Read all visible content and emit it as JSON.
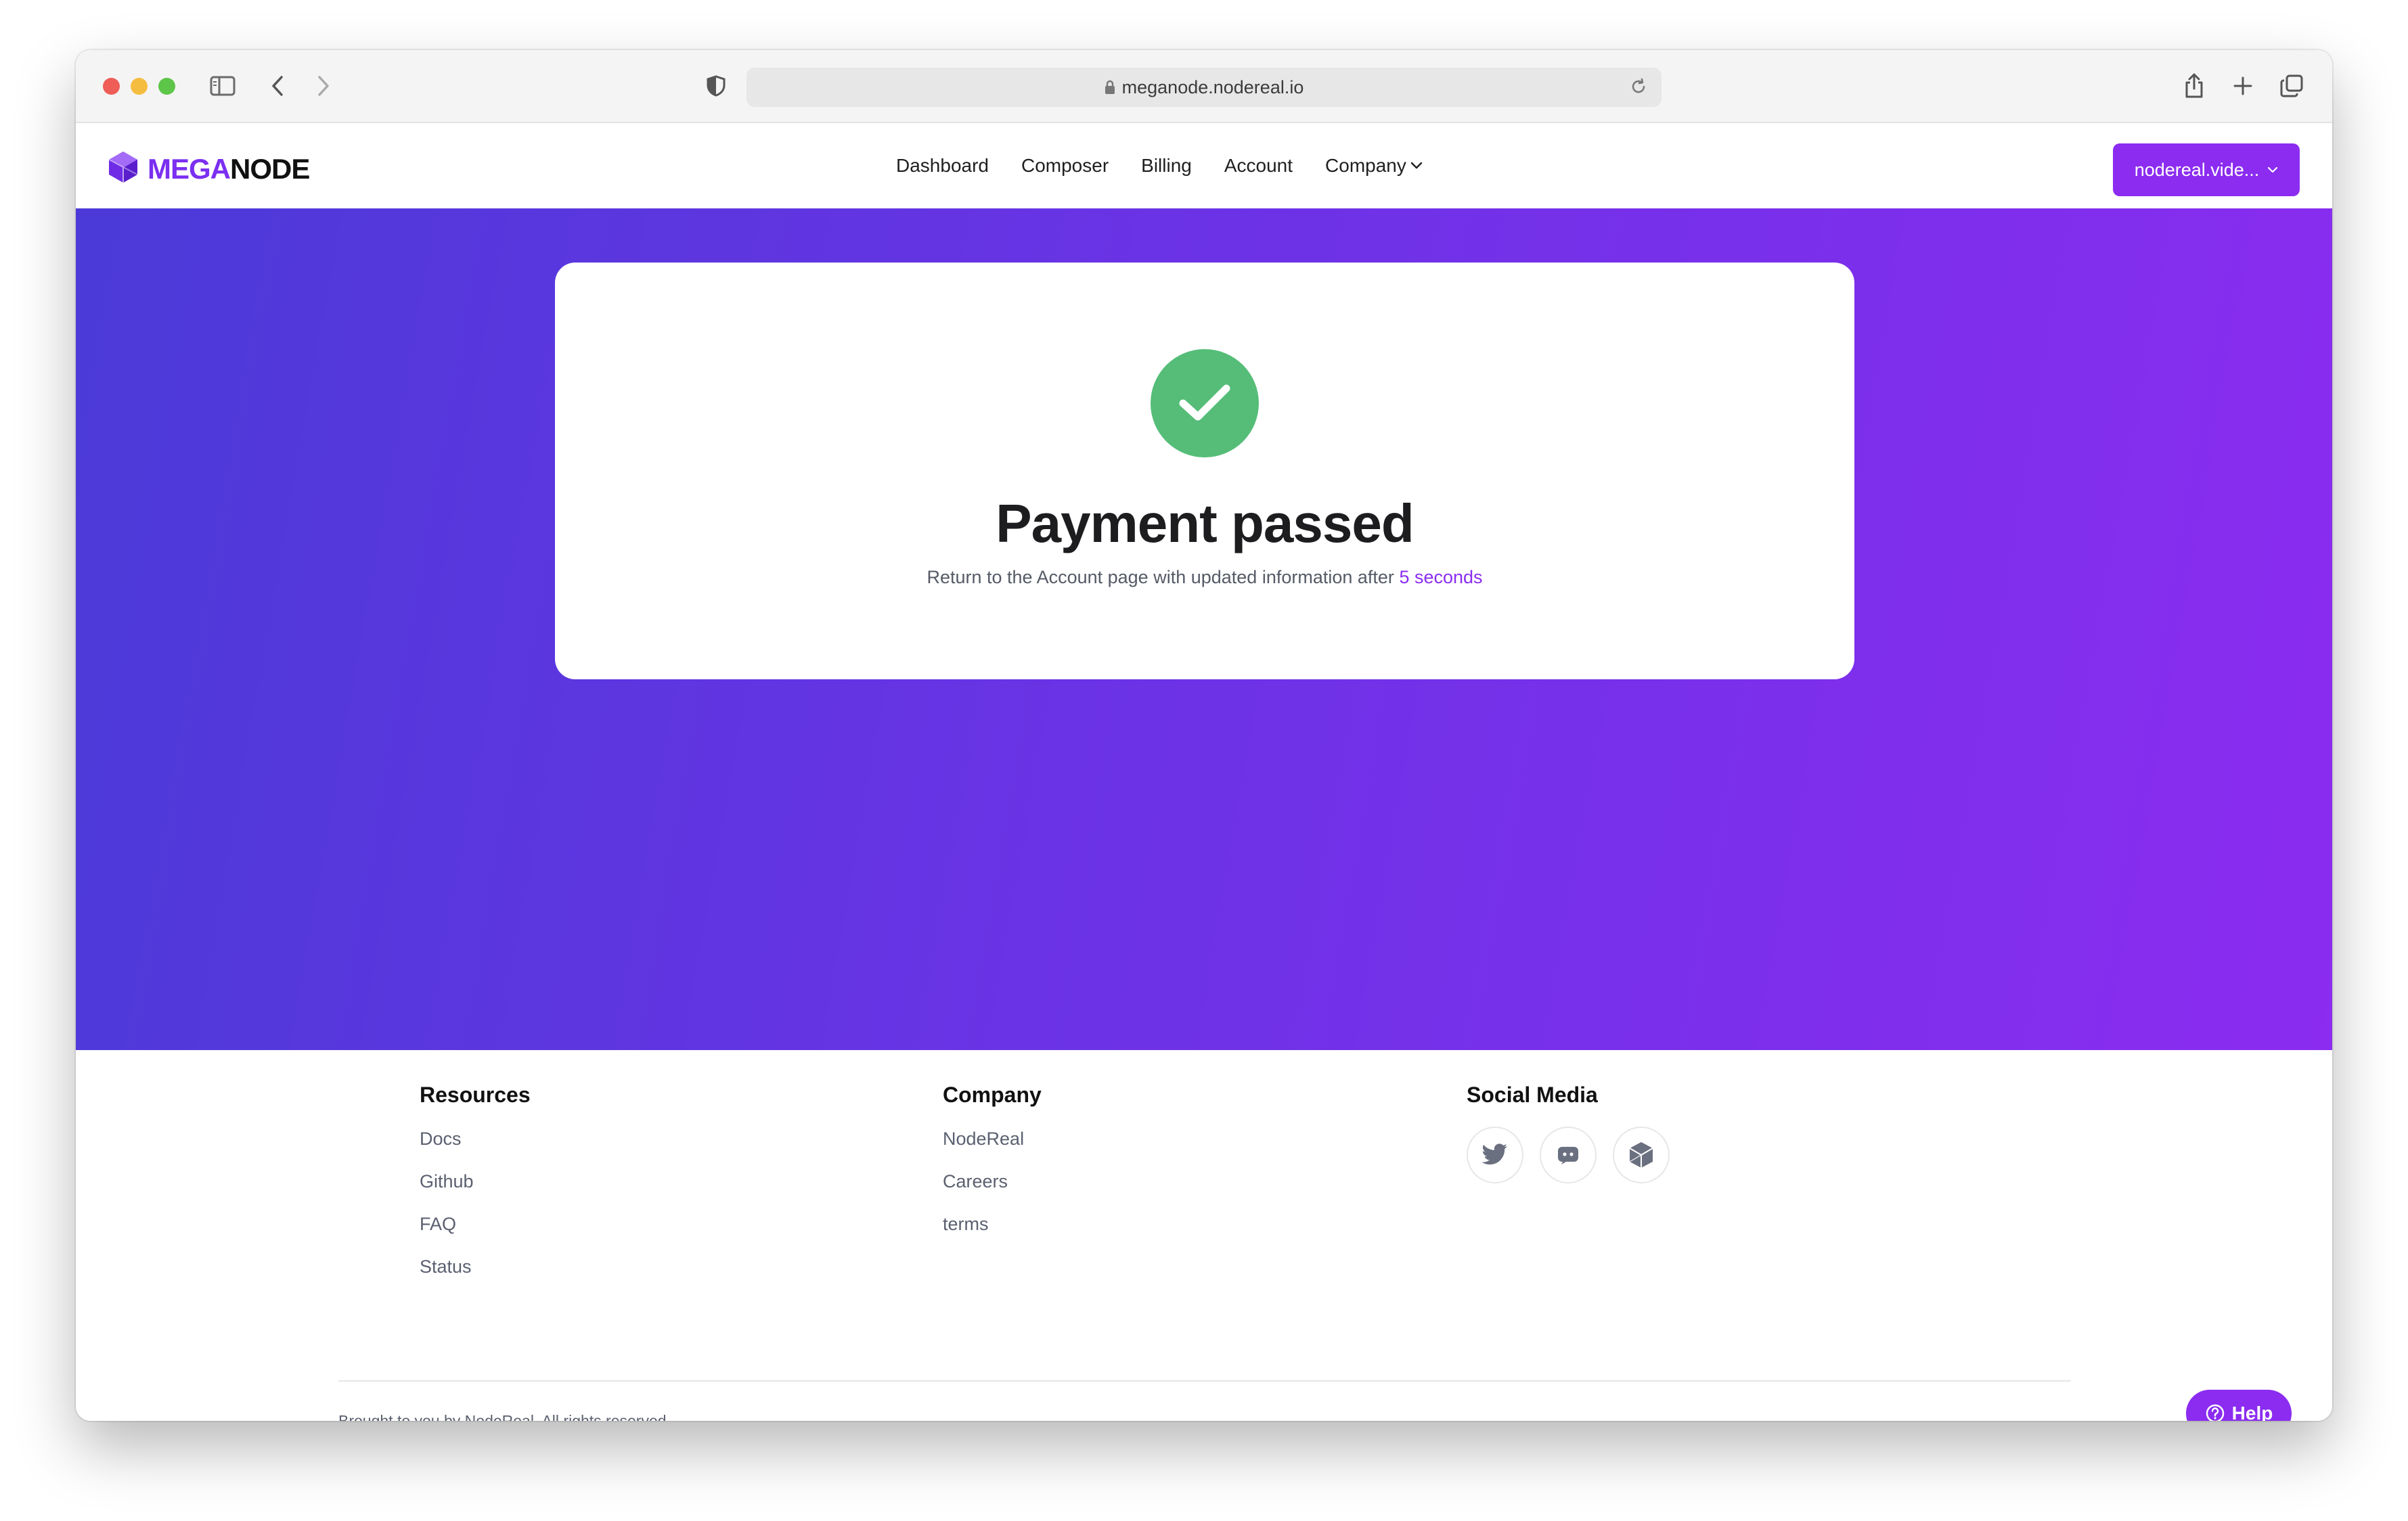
{
  "browser": {
    "url": "meganode.nodereal.io"
  },
  "header": {
    "logo": {
      "mega": "MEGA",
      "node": "NODE"
    },
    "nav": [
      {
        "label": "Dashboard"
      },
      {
        "label": "Composer"
      },
      {
        "label": "Billing"
      },
      {
        "label": "Account"
      },
      {
        "label": "Company"
      }
    ],
    "account_button": "nodereal.vide..."
  },
  "card": {
    "title": "Payment passed",
    "subtitle_prefix": "Return to the Account page with updated information after",
    "subtitle_accent": "5 seconds"
  },
  "footer": {
    "resources": {
      "title": "Resources",
      "links": [
        "Docs",
        "Github",
        "FAQ",
        "Status"
      ]
    },
    "company": {
      "title": "Company",
      "links": [
        "NodeReal",
        "Careers",
        "terms"
      ]
    },
    "social": {
      "title": "Social Media",
      "icons": [
        "twitter-icon",
        "discord-icon",
        "nodereal-icon"
      ]
    },
    "copyright": "Brought to you by NodeReal. All rights reserved.",
    "help": "Help"
  },
  "colors": {
    "brand": "#8b2cf0",
    "gradient_start": "#4b3ad8",
    "gradient_end": "#8b2cf0",
    "success": "#55bd78"
  }
}
